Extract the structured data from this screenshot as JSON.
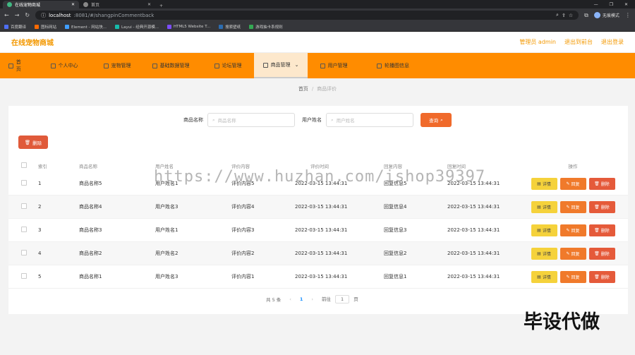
{
  "browser": {
    "tabs": [
      {
        "label": "在线宠物商城",
        "active": true
      },
      {
        "label": "首页",
        "active": false
      }
    ],
    "url_host": "localhost",
    "url_path": ":8081/#/shangpinCommentback",
    "profile_label": "无痕模式",
    "bookmarks": [
      {
        "label": "百度翻译",
        "color": "#4e6ef2"
      },
      {
        "label": "图标网站",
        "color": "#ff6a00"
      },
      {
        "label": "Element - 网站快...",
        "color": "#409eff"
      },
      {
        "label": "Layui - 经典开源模...",
        "color": "#16baaa"
      },
      {
        "label": "HTML5 Website T...",
        "color": "#7c4dff"
      },
      {
        "label": "搜索壁纸",
        "color": "#2b6cb0"
      },
      {
        "label": "游戏抽卡系规则",
        "color": "#34a853"
      }
    ]
  },
  "app": {
    "title": "在线宠物商城",
    "admin_label": "管理员 admin",
    "backend_link": "退出到前台",
    "logout_link": "退出登录"
  },
  "nav": [
    {
      "label": "首页",
      "active": false
    },
    {
      "label": "个人中心",
      "active": false
    },
    {
      "label": "宠物管理",
      "active": false
    },
    {
      "label": "基础数据管理",
      "active": false
    },
    {
      "label": "论坛管理",
      "active": false
    },
    {
      "label": "商品管理",
      "active": true
    },
    {
      "label": "用户管理",
      "active": false
    },
    {
      "label": "轮播图信息",
      "active": false
    }
  ],
  "breadcrumb": {
    "home": "首页",
    "current": "商品评价"
  },
  "search": {
    "product_label": "商品名称",
    "product_placeholder": "商品名称",
    "user_label": "用户姓名",
    "user_placeholder": "用户姓名",
    "button": "查询"
  },
  "delete_button": "删除",
  "table": {
    "headers": [
      "索引",
      "商品名称",
      "用户姓名",
      "评价内容",
      "评价时间",
      "回复内容",
      "回复时间",
      "操作"
    ],
    "rows": [
      {
        "idx": "1",
        "name": "商品名称5",
        "user": "用户姓名1",
        "comment": "评价内容5",
        "time": "2022-03-15 13:44:31",
        "reply": "回复信息5",
        "rtime": "2022-03-15 13:44:31"
      },
      {
        "idx": "2",
        "name": "商品名称4",
        "user": "用户姓名3",
        "comment": "评价内容4",
        "time": "2022-03-15 13:44:31",
        "reply": "回复信息4",
        "rtime": "2022-03-15 13:44:31"
      },
      {
        "idx": "3",
        "name": "商品名称3",
        "user": "用户姓名1",
        "comment": "评价内容3",
        "time": "2022-03-15 13:44:31",
        "reply": "回复信息3",
        "rtime": "2022-03-15 13:44:31"
      },
      {
        "idx": "4",
        "name": "商品名称2",
        "user": "用户姓名2",
        "comment": "评价内容2",
        "time": "2022-03-15 13:44:31",
        "reply": "回复信息2",
        "rtime": "2022-03-15 13:44:31"
      },
      {
        "idx": "5",
        "name": "商品名称1",
        "user": "用户姓名3",
        "comment": "评价内容1",
        "time": "2022-03-15 13:44:31",
        "reply": "回复信息1",
        "rtime": "2022-03-15 13:44:31"
      }
    ],
    "ops": {
      "detail": "详情",
      "reply": "回复",
      "delete": "删除"
    }
  },
  "pager": {
    "total": "共 5 条",
    "page": "1",
    "goto_prefix": "前往",
    "goto_value": "1",
    "goto_suffix": "页"
  },
  "watermark": "https://www.huzhan.com/ishop39397",
  "overlay_text": "毕设代做"
}
